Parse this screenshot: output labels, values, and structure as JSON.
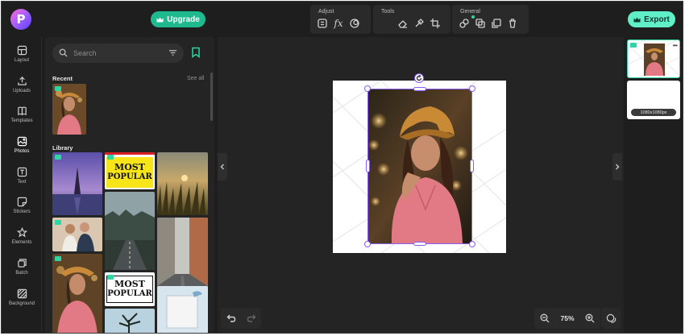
{
  "app": {
    "logo_letter": "P",
    "accent_color": "#1fb98e",
    "selection_color": "#8a5cf5"
  },
  "header": {
    "upgrade_label": "Upgrade",
    "export_label": "Export",
    "groups": [
      {
        "title": "Adjust",
        "icons": [
          "adjust-sliders-icon",
          "fx-icon",
          "filter-icon"
        ]
      },
      {
        "title": "Tools",
        "icons": [
          "eraser-icon",
          "magic-brush-icon",
          "crop-icon"
        ]
      },
      {
        "title": "General",
        "icons": [
          "link-icon",
          "layers-icon",
          "duplicate-icon",
          "trash-icon"
        ]
      }
    ],
    "fx_text": "fx"
  },
  "rail": {
    "items": [
      {
        "label": "Layout",
        "icon": "layout-icon"
      },
      {
        "label": "Uploads",
        "icon": "upload-icon"
      },
      {
        "label": "Templates",
        "icon": "templates-icon"
      },
      {
        "label": "Photos",
        "icon": "photos-icon",
        "active": true
      },
      {
        "label": "Text",
        "icon": "text-icon"
      },
      {
        "label": "Stickers",
        "icon": "stickers-icon"
      },
      {
        "label": "Elements",
        "icon": "elements-icon"
      },
      {
        "label": "Batch",
        "icon": "batch-icon"
      },
      {
        "label": "Background",
        "icon": "background-icon"
      }
    ]
  },
  "panel": {
    "search_placeholder": "Search",
    "recent_title": "Recent",
    "see_all": "See all",
    "library_title": "Library",
    "sticker_text_1": "MOST",
    "sticker_text_2": "POPULAR"
  },
  "canvas": {
    "zoom": "75%"
  },
  "pages": {
    "page2_dims": "1080x1080px"
  }
}
